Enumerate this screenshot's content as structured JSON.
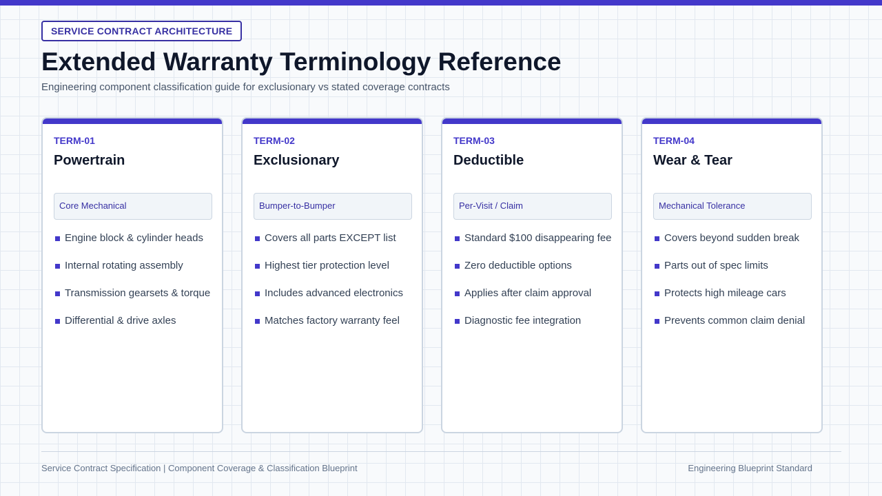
{
  "header": {
    "badge": "SERVICE CONTRACT ARCHITECTURE",
    "title": "Extended Warranty Terminology Reference",
    "subtitle": "Engineering component classification guide for exclusionary vs stated coverage contracts"
  },
  "cards": [
    {
      "id": "TERM-01",
      "title": "Powertrain",
      "tag": "Core Mechanical",
      "items": [
        "Engine block & cylinder heads",
        "Internal rotating assembly",
        "Transmission gearsets & torque",
        "Differential & drive axles"
      ]
    },
    {
      "id": "TERM-02",
      "title": "Exclusionary",
      "tag": "Bumper-to-Bumper",
      "items": [
        "Covers all parts EXCEPT list",
        "Highest tier protection level",
        "Includes advanced electronics",
        "Matches factory warranty feel"
      ]
    },
    {
      "id": "TERM-03",
      "title": "Deductible",
      "tag": "Per-Visit / Claim",
      "items": [
        "Standard $100 disappearing fee",
        "Zero deductible options",
        "Applies after claim approval",
        "Diagnostic fee integration"
      ]
    },
    {
      "id": "TERM-04",
      "title": "Wear & Tear",
      "tag": "Mechanical Tolerance",
      "items": [
        "Covers beyond sudden break",
        "Parts out of spec limits",
        "Protects high mileage cars",
        "Prevents common claim denial"
      ]
    }
  ],
  "footer": {
    "left": "Service Contract Specification | Component Coverage & Classification Blueprint",
    "right": "Engineering Blueprint Standard"
  },
  "colors": {
    "accent": "#4338ca",
    "heading": "#0f172a",
    "border": "#cbd5e1"
  }
}
